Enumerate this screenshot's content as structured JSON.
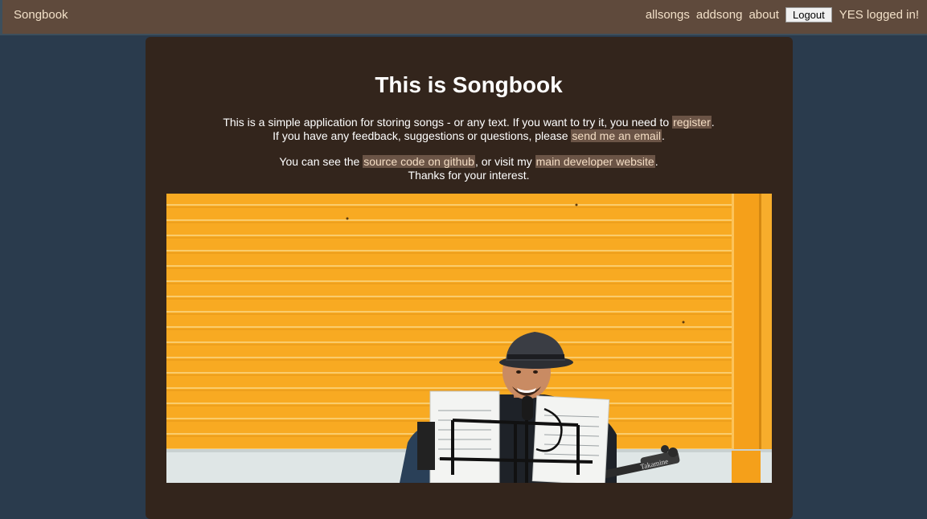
{
  "nav": {
    "brand": "Songbook",
    "items": [
      "allsongs",
      "addsong",
      "about"
    ],
    "logout_label": "Logout",
    "status": "YES logged in!"
  },
  "main": {
    "title": "This is Songbook",
    "p1": {
      "line1_before": "This is a simple application for storing songs - or any text. If you want to try it, you need to ",
      "link_register": "register",
      "line1_after": ".",
      "line2_before": "If you have any feedback, suggestions or questions, please ",
      "link_email": "send me an email",
      "line2_after": "."
    },
    "p2": {
      "line1_before": "You can see the ",
      "link_github": "source code on github",
      "line1_mid": ", or visit my ",
      "link_website": "main developer website",
      "line1_after": ".",
      "line2": "Thanks for your interest."
    },
    "hero": {
      "guitar_brand": "Takamine"
    }
  },
  "colors": {
    "page_bg": "#2a3b4d",
    "topbar_bg": "#5f4a3c",
    "card_bg": "#33251c",
    "link_bg": "#6b5446",
    "shutter": "#f8aa22"
  }
}
